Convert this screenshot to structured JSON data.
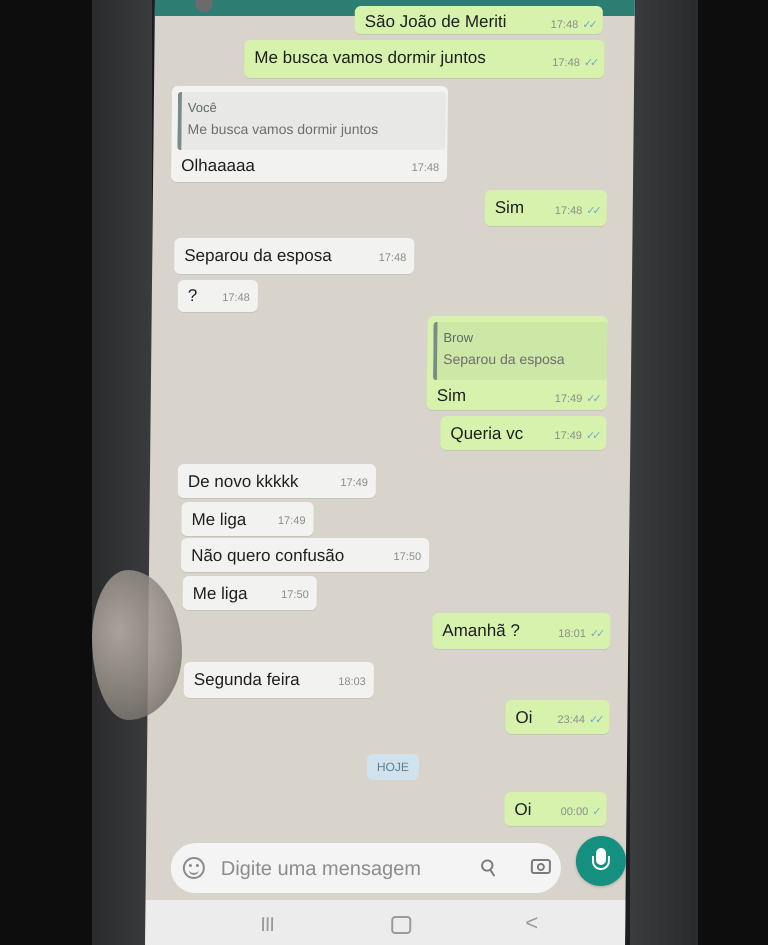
{
  "app": {
    "accent": "#159080",
    "incoming_bg": "#f2f2f0",
    "outgoing_bg": "#d6f2ad"
  },
  "messages": [
    {
      "id": "m0",
      "dir": "out",
      "text": "São João de Meriti",
      "time": "17:48",
      "ticks": "✓✓"
    },
    {
      "id": "m1",
      "dir": "out",
      "text": "Me busca vamos dormir juntos",
      "time": "17:48",
      "ticks": "✓✓"
    },
    {
      "id": "m2",
      "dir": "in",
      "quote_author": "Você",
      "quote_text": "Me busca vamos dormir juntos",
      "text": "Olhaaaaa",
      "time": "17:48"
    },
    {
      "id": "m3",
      "dir": "out",
      "text": "Sim",
      "time": "17:48",
      "ticks": "✓✓"
    },
    {
      "id": "m4",
      "dir": "in",
      "text": "Separou da esposa",
      "time": "17:48"
    },
    {
      "id": "m5",
      "dir": "in",
      "text": "?",
      "time": "17:48"
    },
    {
      "id": "m6",
      "dir": "out",
      "quote_author": "Brow",
      "quote_text": "Separou da esposa",
      "text": "Sim",
      "time": "17:49",
      "ticks": "✓✓"
    },
    {
      "id": "m7",
      "dir": "out",
      "text": "Queria vc",
      "time": "17:49",
      "ticks": "✓✓"
    },
    {
      "id": "m8",
      "dir": "in",
      "text": "De novo kkkkk",
      "time": "17:49"
    },
    {
      "id": "m9",
      "dir": "in",
      "text": "Me liga",
      "time": "17:49"
    },
    {
      "id": "m10",
      "dir": "in",
      "text": "Não quero confusão",
      "time": "17:50"
    },
    {
      "id": "m11",
      "dir": "in",
      "text": "Me liga",
      "time": "17:50"
    },
    {
      "id": "m12",
      "dir": "out",
      "text": "Amanhã ?",
      "time": "18:01",
      "ticks": "✓✓"
    },
    {
      "id": "m13",
      "dir": "in",
      "text": "Segunda feira",
      "time": "18:03"
    },
    {
      "id": "m14",
      "dir": "out",
      "text": "Oi",
      "time": "23:44",
      "ticks": "✓✓"
    },
    {
      "id": "m15",
      "dir": "out",
      "text": "Oi",
      "time": "00:00",
      "ticks": "✓"
    }
  ],
  "date_separator": "HOJE",
  "composer": {
    "placeholder": "Digite uma mensagem"
  },
  "icons": {
    "emoji": "emoji-icon",
    "attach": "paperclip-icon",
    "camera": "camera-icon",
    "mic": "mic-icon",
    "recent": "recent-apps-icon",
    "home": "home-icon",
    "back": "back-icon"
  },
  "navbar": {
    "recent_glyph": "III",
    "back_glyph": "<"
  }
}
